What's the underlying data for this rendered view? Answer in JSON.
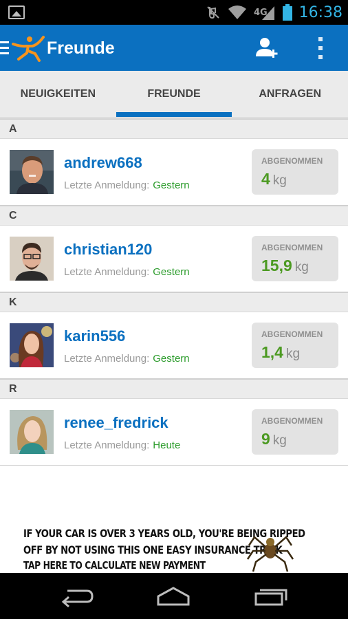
{
  "status_bar": {
    "time": "16:38",
    "network": "4G",
    "icons": [
      "gallery-icon",
      "mute-icon",
      "wifi-icon",
      "network-icon",
      "signal-icon",
      "battery-icon"
    ]
  },
  "action_bar": {
    "title": "Freunde",
    "icons": [
      "menu-icon",
      "logo-icon",
      "add-friend-icon",
      "overflow-menu-icon"
    ],
    "color": "#0b70c0"
  },
  "tabs": [
    {
      "label": "NEUIGKEITEN",
      "active": false
    },
    {
      "label": "FREUNDE",
      "active": true
    },
    {
      "label": "ANFRAGEN",
      "active": false
    }
  ],
  "friends": {
    "login_label": "Letzte Anmeldung:",
    "lost_label": "ABGENOMMEN",
    "unit": "kg",
    "sections": [
      {
        "letter": "A",
        "user": {
          "name": "andrew668",
          "last_login": "Gestern",
          "lost": "4"
        }
      },
      {
        "letter": "C",
        "user": {
          "name": "christian120",
          "last_login": "Gestern",
          "lost": "15,9"
        }
      },
      {
        "letter": "K",
        "user": {
          "name": "karin556",
          "last_login": "Gestern",
          "lost": "1,4"
        }
      },
      {
        "letter": "R",
        "user": {
          "name": "renee_fredrick",
          "last_login": "Heute",
          "lost": "9"
        }
      }
    ]
  },
  "ad": {
    "line1": "IF YOUR CAR IS OVER 3 YEARS OLD, YOU'RE BEING RIPPED",
    "line2": "OFF BY NOT USING THIS ONE EASY INSURANCE TRICK",
    "line3": "TAP HERE TO CALCULATE NEW PAYMENT"
  },
  "nav_bar": {
    "icons": [
      "back-icon",
      "home-icon",
      "recents-icon"
    ]
  },
  "colors": {
    "accent": "#0b70c0",
    "green": "#4c9a22",
    "status_time": "#33b5e5"
  }
}
